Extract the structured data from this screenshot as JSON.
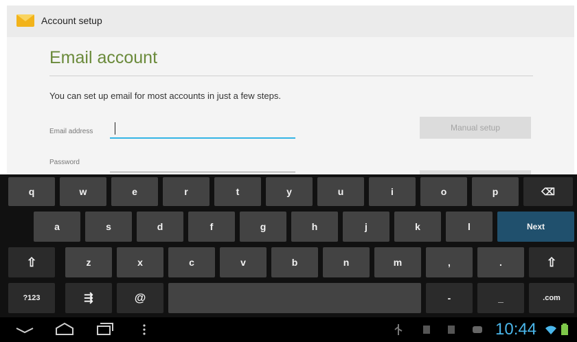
{
  "action_bar": {
    "title": "Account setup"
  },
  "form": {
    "heading": "Email account",
    "intro": "You can set up email for most accounts in just a few steps.",
    "email_label": "Email address",
    "email_value": "",
    "password_label": "Password",
    "password_value": "",
    "manual_setup_label": "Manual setup"
  },
  "keyboard": {
    "row1": [
      "q",
      "w",
      "e",
      "r",
      "t",
      "y",
      "u",
      "i",
      "o",
      "p"
    ],
    "row2": [
      "a",
      "s",
      "d",
      "f",
      "g",
      "h",
      "j",
      "k",
      "l"
    ],
    "row3": [
      "z",
      "x",
      "c",
      "v",
      "b",
      "n",
      "m",
      ",",
      "."
    ],
    "next_label": "Next",
    "symbols_label": "?123",
    "at_label": "@",
    "dash_label": "-",
    "underscore_label": "_",
    "dotcom_label": ".com",
    "shift_glyph": "⇧",
    "backspace_glyph": "⌫",
    "settings_glyph": "⇶"
  },
  "status_bar": {
    "time": "10:44"
  },
  "colors": {
    "accent": "#33b5e5",
    "heading_green": "#6a8a3a",
    "next_key": "#20506d",
    "clock": "#4ab6ea"
  },
  "icons": [
    "email-app-icon",
    "back-icon",
    "home-icon",
    "recent-apps-icon",
    "menu-icon",
    "usb-icon",
    "notification-icon",
    "wifi-icon",
    "battery-icon"
  ]
}
